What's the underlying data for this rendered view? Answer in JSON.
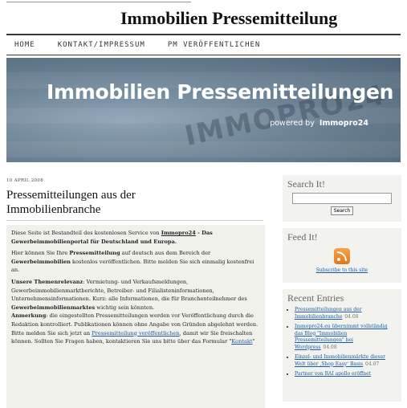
{
  "site": {
    "title": "Immobilien Pressemitteilung"
  },
  "nav": [
    "HOME",
    "KONTAKT/IMPRESSUM",
    "PM VERÖFFENTLICHEN"
  ],
  "banner": {
    "headline": "Immobilien Pressemitteilungen",
    "powered_by": "powered by",
    "brand": "Immopro24",
    "watermark": "IMMOPRO24"
  },
  "post": {
    "date": "10 APRIL 2008",
    "title": "Pressemitteilungen aus der Immobilienbranche",
    "p1_a": "Diese Seite ist Bestandteil des kostenlosen Service von ",
    "p1_brand": "Immopro24",
    "p1_b": " - Das Gewerbeimmobilienportal für Deutschland und Europa.",
    "p2_a": "Hier können Sie Ihre ",
    "p2_b1": "Pressemitteilung",
    "p2_c": " auf deutsch aus dem Bereich der ",
    "p2_b2": "Gewerbeimmobilien",
    "p2_d": " kostenlos veröffentlichen. Bitte melden Sie sich einmalig kostenfrei an.",
    "p3_label": "Unsere Themenrelevanz",
    "p3_a": ": Vermietung- und Verkaufsmeldungen, Gewerbeimmobilienmarktberichte, Betreiber- und Filialisteninformationen, Unternehmensinformationen. Kurz: alle Informationen, die für Branchenteilnehmer des ",
    "p3_b": "Gewerbeimmobilienmarktes",
    "p3_c": " wichtig sein könnten.",
    "p4_label": "Anmerkung",
    "p4_a": ": die eingestellten Pressemitteilungen werden vor Veröffentlichung durch die Redaktion kontrolliert. Publikationen können ohne Angabe von Gründen abgelehnt werden.",
    "p5_a": "Bitte melden Sie sich jetzt an ",
    "p5_link": "Pressemitteilung veröffentlichen",
    "p5_b": ", damit wir Sie freischalten können. Sollten Sie Fragen haben, kontaktieren Sie uns bitte über das Formular \"",
    "p5_link2": "Kontakt",
    "p5_c": "\""
  },
  "sidebar": {
    "search_title": "Search It!",
    "search_value": "",
    "search_button": "Search",
    "feed_title": "Feed It!",
    "feed_link": "Subscribe to this site",
    "recent_title": "Recent Entries",
    "entries": [
      {
        "title": "Pressemitteilungen aus der Immobilienbranche",
        "date": "04.08"
      },
      {
        "title": "Immopro24.eu übernimmt vollständig das Blog \"Immobilien Pressemitteilungen\" bei Wordpress",
        "date": "04.08"
      },
      {
        "title": "Einzel- und Immobilienmärkte dieser Welt über ‚Shop Easy‘ Basis",
        "date": "04.07"
      },
      {
        "title": "Partner von BAI apollo eröffnet",
        "date": ""
      }
    ]
  },
  "colors": {
    "link": "#1a5aa6",
    "banner": "#6d8396",
    "panel": "#f1f1ec"
  }
}
